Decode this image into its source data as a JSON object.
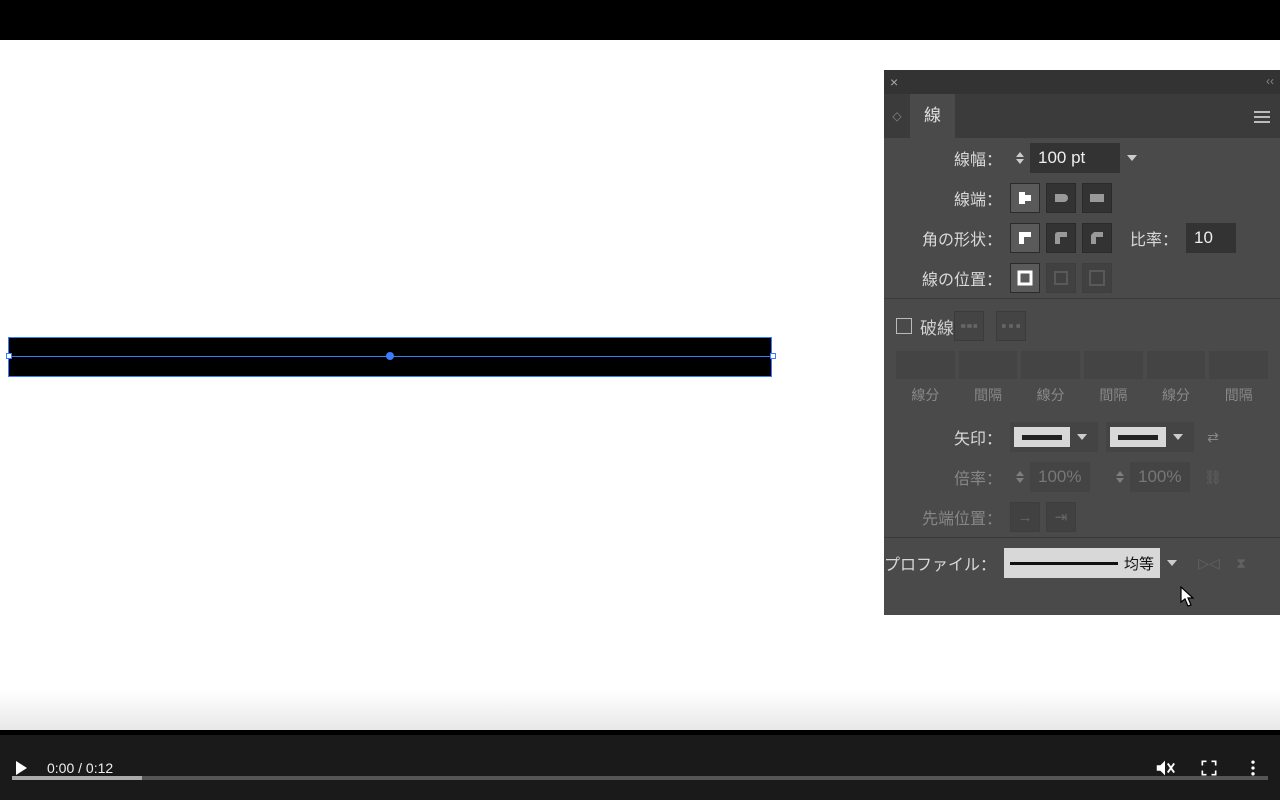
{
  "panel": {
    "title": "線",
    "weight_label": "線幅：",
    "weight_value": "100 pt",
    "cap_label": "線端：",
    "corner_label": "角の形状：",
    "miter_label": "比率：",
    "miter_value": "10",
    "align_label": "線の位置：",
    "dashed_label": "破線",
    "dash_cols": [
      "線分",
      "間隔",
      "線分",
      "間隔",
      "線分",
      "間隔"
    ],
    "arrow_label": "矢印：",
    "scale_label": "倍率：",
    "scale_value1": "100%",
    "scale_value2": "100%",
    "tip_label": "先端位置：",
    "profile_label": "プロファイル：",
    "profile_value": "均等"
  },
  "video": {
    "time": "0:00 / 0:12"
  }
}
